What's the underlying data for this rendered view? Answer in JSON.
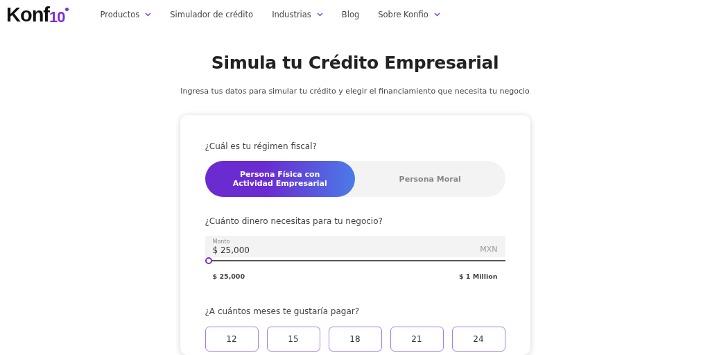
{
  "logo": {
    "text": "Konf",
    "accent": "10"
  },
  "nav": [
    {
      "label": "Productos",
      "dropdown": true
    },
    {
      "label": "Simulador de crédito",
      "dropdown": false
    },
    {
      "label": "Industrias",
      "dropdown": true
    },
    {
      "label": "Blog",
      "dropdown": false
    },
    {
      "label": "Sobre Konfio",
      "dropdown": true
    }
  ],
  "title": "Simula tu Crédito Empresarial",
  "subtitle": "Ingresa tus datos para simular tu crédito y elegir el financiamiento que necesita tu negocio",
  "regimen": {
    "question": "¿Cuál es tu régimen fiscal?",
    "options": [
      {
        "label": "Persona Física con Actividad Empresarial",
        "selected": true
      },
      {
        "label": "Persona Moral",
        "selected": false
      }
    ]
  },
  "amount": {
    "question": "¿Cuánto dinero necesitas para tu negocio?",
    "field_label": "Monto",
    "value": "$ 25,000",
    "currency": "MXN",
    "level": 0,
    "min_label": "$ 25,000",
    "max_label": "$ 1 Million"
  },
  "months": {
    "question": "¿A cuántos meses te gustaría pagar?",
    "options": [
      {
        "label": "12",
        "selected": false
      },
      {
        "label": "15",
        "selected": false
      },
      {
        "label": "18",
        "selected": false
      },
      {
        "label": "21",
        "selected": false
      },
      {
        "label": "24",
        "selected": false
      }
    ]
  }
}
